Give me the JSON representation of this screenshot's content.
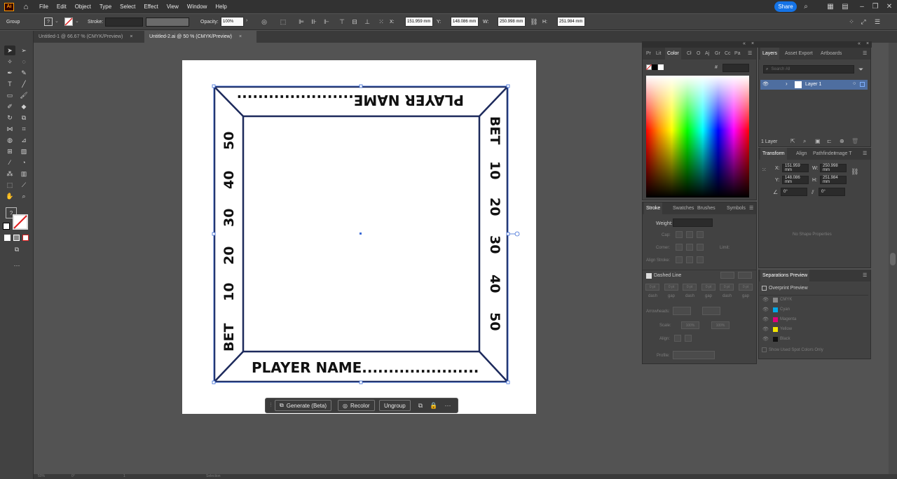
{
  "menubar": {
    "logo": "Ai",
    "items": [
      "File",
      "Edit",
      "Object",
      "Type",
      "Select",
      "Effect",
      "View",
      "Window",
      "Help"
    ],
    "share": "Share"
  },
  "controlbar": {
    "selection_type": "Group",
    "stroke_label": "Stroke:",
    "opacity_label": "Opacity:",
    "opacity_value": "100%",
    "x_label": "X:",
    "x_value": "151.959 mm",
    "y_label": "Y:",
    "y_value": "148.086 mm",
    "w_label": "W:",
    "w_value": "250.998 mm",
    "h_label": "H:",
    "h_value": "251.984 mm"
  },
  "tabs": [
    {
      "label": "Untitled-1 @ 66.67 % (CMYK/Preview)"
    },
    {
      "label": "Untitled-2.ai @ 50 % (CMYK/Preview)"
    }
  ],
  "artwork": {
    "top_text": "PLAYER NAME......................",
    "bottom_text": "PLAYER NAME......................",
    "left_labels": [
      "BET",
      "10",
      "20",
      "30",
      "40",
      "50"
    ],
    "right_labels": [
      "BET",
      "10",
      "20",
      "30",
      "40",
      "50"
    ],
    "frame_color": "#1d2a5c",
    "selection_color": "#3c6bd6"
  },
  "contextbar": {
    "generate": "Generate (Beta)",
    "recolor": "Recolor",
    "ungroup": "Ungroup"
  },
  "color_panel": {
    "tabs": [
      "Pr",
      "Lit",
      "Color",
      "Cł",
      "O",
      "Aj",
      "Gr",
      "Cc",
      "Pa"
    ],
    "hex_label": "#"
  },
  "stroke_panel": {
    "tabs": [
      "Stroke",
      "Swatches",
      "Brushes",
      "Symbols"
    ],
    "weight_label": "Weight:",
    "cap_label": "Cap:",
    "corner_label": "Corner:",
    "limit_label": "Limit:",
    "align_label": "Align Stroke:",
    "dashed_label": "Dashed Line",
    "dash_values": [
      "0 pt",
      "0 pt",
      "0 pt",
      "0 pt",
      "0 pt",
      "0 pt"
    ],
    "dash_labels": [
      "dash",
      "gap",
      "dash",
      "gap",
      "dash",
      "gap"
    ],
    "arrowheads_label": "Arrowheads:",
    "scale_label": "Scale:",
    "scale_values": [
      "100%",
      "100%"
    ],
    "align2_label": "Align:",
    "profile_label": "Profile:"
  },
  "layers_panel": {
    "tabs": [
      "Layers",
      "Asset Export",
      "Artboards"
    ],
    "search_placeholder": "Search All",
    "layer_name": "Layer 1",
    "count": "1 Layer"
  },
  "transform_panel": {
    "tabs": [
      "Transform",
      "Align",
      "Pathfinder",
      "Image T"
    ],
    "x_label": "X:",
    "x_value": "151.959 mm",
    "w_label": "W:",
    "w_value": "250.998 mm",
    "y_label": "Y:",
    "y_value": "148.086 mm",
    "h_label": "H:",
    "h_value": "251.984 mm",
    "angle_value": "0°",
    "shear_value": "0°",
    "no_shape": "No Shape Properties"
  },
  "separations_panel": {
    "title": "Separations Preview",
    "overprint": "Overprint Preview",
    "inks": [
      {
        "name": "CMYK",
        "color": "#888888"
      },
      {
        "name": "Cyan",
        "color": "#00a8e8"
      },
      {
        "name": "Magenta",
        "color": "#e0007a"
      },
      {
        "name": "Yellow",
        "color": "#f2e400"
      },
      {
        "name": "Black",
        "color": "#111111"
      }
    ],
    "show_spot": "Show Used Spot Colors Only"
  },
  "statusbar": {
    "zoom": "50%",
    "angle": "0°",
    "artboard": "1",
    "mode": "Selection"
  }
}
